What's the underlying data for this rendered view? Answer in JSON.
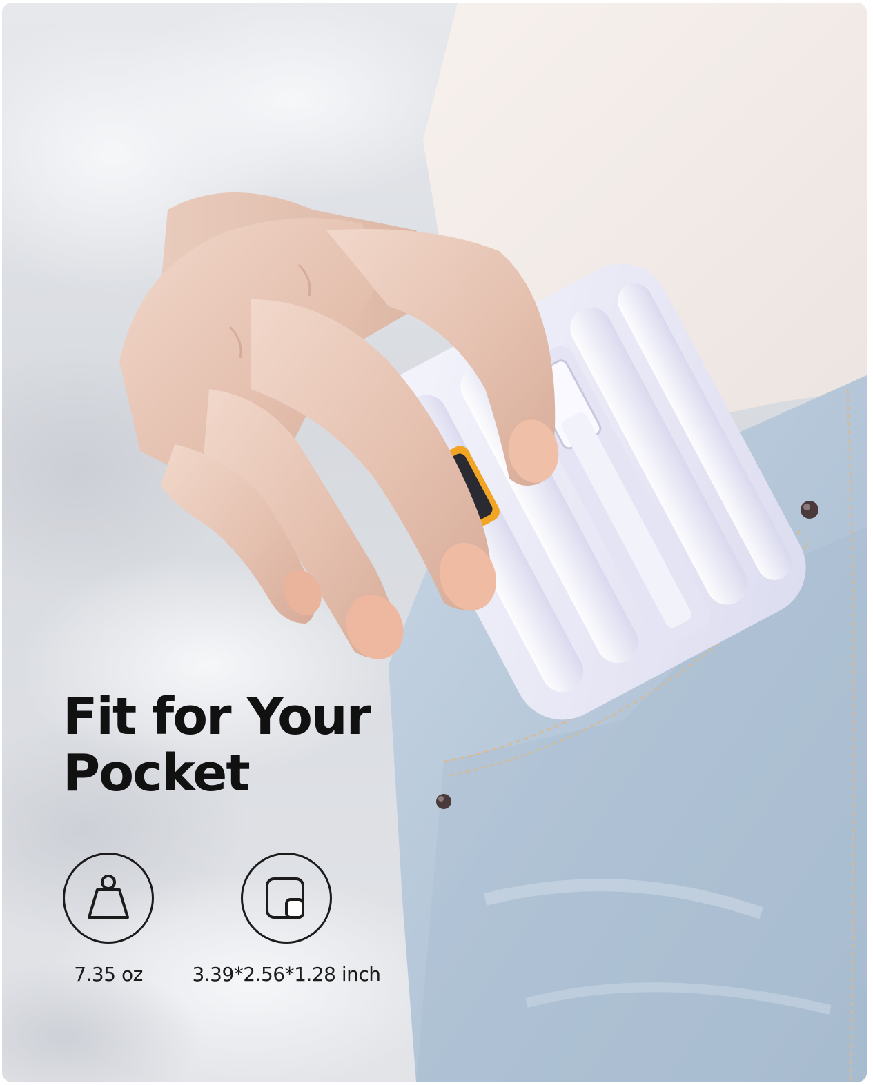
{
  "headline": {
    "line1": "Fit for Your",
    "line2": "Pocket"
  },
  "specs": [
    {
      "icon": "weight-icon",
      "label": "7.35 oz"
    },
    {
      "icon": "dimensions-icon",
      "label": "3.39*2.56*1.28 inch"
    }
  ],
  "colors": {
    "background": "#e3e5e9",
    "denim": "#b7c9db",
    "shirt": "#f4eeeb",
    "device": "#e9e9f7",
    "text": "#111111"
  }
}
